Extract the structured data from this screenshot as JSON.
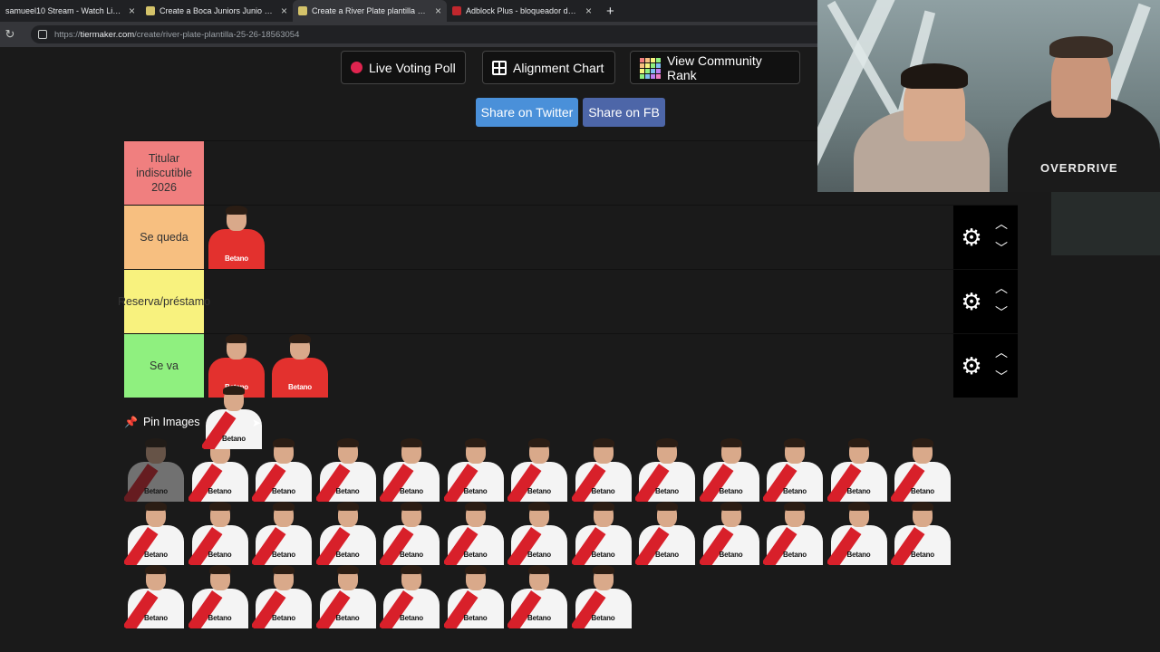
{
  "browser": {
    "tabs": [
      {
        "title": "samueel10 Stream - Watch Live o",
        "favicon_color": "#9146ff",
        "active": false
      },
      {
        "title": "Create a Boca Juniors Junio 2025",
        "favicon_color": "#d4c36a",
        "active": false
      },
      {
        "title": "Create a River Plate plantilla 25/2",
        "favicon_color": "#d4c36a",
        "active": true
      },
      {
        "title": "Adblock Plus - bloqueador de an",
        "favicon_color": "#c1272d",
        "active": false
      }
    ],
    "url_prefix": "https://",
    "url_host": "tiermaker.com",
    "url_path": "/create/river-plate-plantilla-25-26-18563054"
  },
  "toolbar": {
    "live_voting_label": "Live Voting Poll",
    "alignment_label": "Alignment Chart",
    "community_rank_label": "View Community Rank",
    "share_twitter_label": "Share on Twitter",
    "share_fb_label": "Share on FB"
  },
  "colors": {
    "twitter": "#4a90d9",
    "facebook": "#4d66a8",
    "tier_1": "#f07f7f",
    "tier_2": "#f7bf80",
    "tier_3": "#f8f27e",
    "tier_4": "#8ff07f"
  },
  "tiers": [
    {
      "label": "Titular indiscutible 2026",
      "color": "#f07f7f",
      "cards": 0
    },
    {
      "label": "Se queda",
      "color": "#f7bf80",
      "cards": 1
    },
    {
      "label": "Reserva/préstamo",
      "color": "#f8f27e",
      "cards": 0
    },
    {
      "label": "Se va",
      "color": "#8ff07f",
      "cards": 2
    }
  ],
  "pin_images_label": "Pin Images",
  "sponsor_text": "Betano",
  "pool_card_count": 34,
  "webcam": {
    "shirt_text": "OVERDRIVE"
  }
}
